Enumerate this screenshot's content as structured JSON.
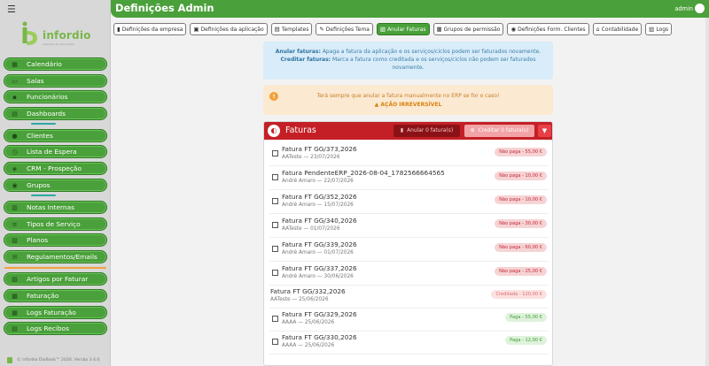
{
  "header": {
    "title": "Definições Admin",
    "user": "admin"
  },
  "sidebar": {
    "brand": "infordio",
    "tagline": "sistemas de informação",
    "items": [
      {
        "label": "Calendário",
        "icon": "calendar-icon"
      },
      {
        "label": "Salas",
        "icon": "rooms-icon"
      },
      {
        "label": "Funcionários",
        "icon": "staff-icon"
      },
      {
        "label": "Dashboards",
        "icon": "dashboard-icon"
      },
      {
        "label": "Clientes",
        "icon": "clients-icon"
      },
      {
        "label": "Lista de Espera",
        "icon": "waitlist-icon"
      },
      {
        "label": "CRM - Prospeção",
        "icon": "crm-icon"
      },
      {
        "label": "Grupos",
        "icon": "groups-icon"
      },
      {
        "label": "Notas Internas",
        "icon": "notes-icon"
      },
      {
        "label": "Tipos de Serviço",
        "icon": "service-types-icon"
      },
      {
        "label": "Planos",
        "icon": "plans-icon"
      },
      {
        "label": "Regulamentos/Emails",
        "icon": "regulations-icon"
      },
      {
        "label": "Artigos por Faturar",
        "icon": "articles-icon"
      },
      {
        "label": "Faturação",
        "icon": "billing-icon"
      },
      {
        "label": "Logs Faturação",
        "icon": "billing-logs-icon"
      },
      {
        "label": "Logs Recibos",
        "icon": "receipt-logs-icon"
      }
    ],
    "footer": "© infordio DioBook™ 2026. Versão 3.4.0."
  },
  "tabs": [
    {
      "label": "Definições da empresa",
      "icon": "building-icon"
    },
    {
      "label": "Definições da aplicação",
      "icon": "app-settings-icon"
    },
    {
      "label": "Templates",
      "icon": "template-icon"
    },
    {
      "label": "Definições Tema",
      "icon": "palette-icon"
    },
    {
      "label": "Anular Faturas",
      "icon": "invoice-cancel-icon",
      "active": true
    },
    {
      "label": "Grupos de permissão",
      "icon": "permission-groups-icon"
    },
    {
      "label": "Definições Form. Clientes",
      "icon": "client-form-icon"
    },
    {
      "label": "Contabilidade",
      "icon": "accounting-icon"
    },
    {
      "label": "Logs",
      "icon": "logs-icon"
    }
  ],
  "info": {
    "line1_label": "Anular faturas:",
    "line1_text": "Apaga a fatura da aplicação e os serviços/ciclos podem ser faturados novamente.",
    "line2_label": "Creditar faturas:",
    "line2_text": "Marca a fatura como creditada e os serviços/ciclos não podem ser faturados",
    "line3_text": "novamente."
  },
  "warning": {
    "text": "Terá sempre que anular a fatura manualmente no ERP se for o caso!",
    "action": "AÇÃO IRREVERSÍVEL"
  },
  "panel": {
    "title": "Faturas",
    "anular_label": "Anular 0 fatura(s)",
    "creditar_label": "Creditar 0 fatura(s)",
    "rows": [
      {
        "title": "Fatura FT GG/373,2026",
        "sub": "AATeste — 23/07/2026",
        "badge": "Não paga - 55,00 €",
        "status": "np",
        "checkbox": true
      },
      {
        "title": "Fatura PendenteERP_2026-08-04_1782566664565",
        "sub": "André Amaro — 22/07/2026",
        "badge": "Não paga - 10,00 €",
        "status": "np",
        "checkbox": true
      },
      {
        "title": "Fatura FT GG/352,2026",
        "sub": "André Amaro — 15/07/2026",
        "badge": "Não paga - 10,00 €",
        "status": "np",
        "checkbox": true
      },
      {
        "title": "Fatura FT GG/340,2026",
        "sub": "AATeste — 01/07/2026",
        "badge": "Não paga - 30,00 €",
        "status": "np",
        "checkbox": true
      },
      {
        "title": "Fatura FT GG/339,2026",
        "sub": "André Amaro — 01/07/2026",
        "badge": "Não paga - 60,00 €",
        "status": "np",
        "checkbox": true
      },
      {
        "title": "Fatura FT GG/337,2026",
        "sub": "André Amaro — 30/06/2026",
        "badge": "Não paga - 25,00 €",
        "status": "np",
        "checkbox": true
      },
      {
        "title": "Fatura FT GG/332,2026",
        "sub": "AATeste — 25/06/2026",
        "badge": "Creditada - 120,00 €",
        "status": "cr",
        "checkbox": false
      },
      {
        "title": "Fatura FT GG/329,2026",
        "sub": "AAAA — 25/06/2026",
        "badge": "Paga - 55,00 €",
        "status": "pg",
        "checkbox": true
      },
      {
        "title": "Fatura FT GG/330,2026",
        "sub": "AAAA — 25/06/2026",
        "badge": "Paga - 12,00 €",
        "status": "pg",
        "checkbox": true
      }
    ]
  }
}
